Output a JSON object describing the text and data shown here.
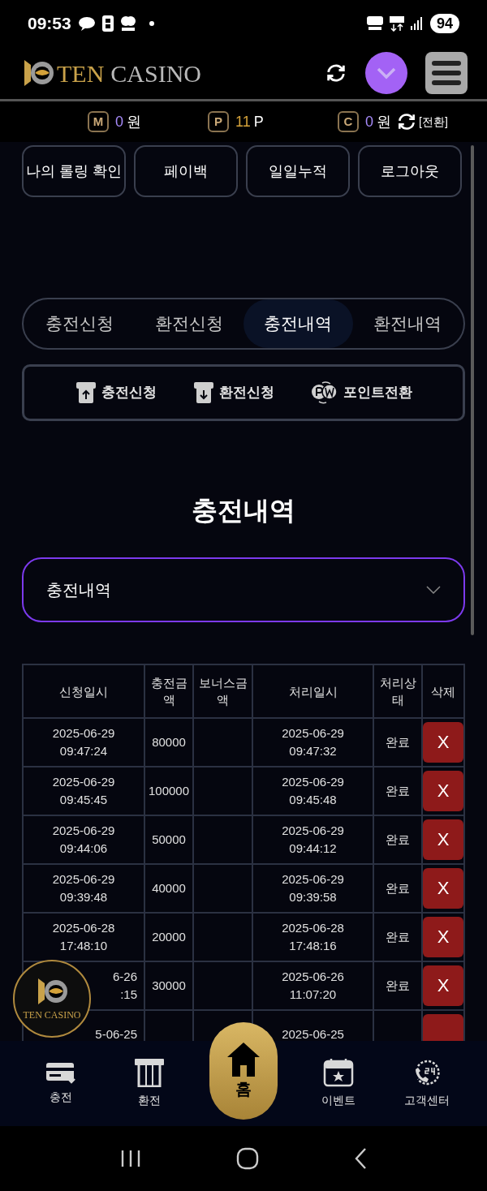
{
  "status_bar": {
    "time": "09:53",
    "battery": "94"
  },
  "header": {
    "logo_left": "TEN",
    "logo_right": "CASINO"
  },
  "balances": [
    {
      "badge": "M",
      "amount": "0",
      "unit": "원",
      "color": "#a78bfa"
    },
    {
      "badge": "P",
      "amount": "11",
      "unit": "P",
      "color": "#d4a23a"
    },
    {
      "badge": "C",
      "amount": "0",
      "unit": "원",
      "color": "#a78bfa"
    }
  ],
  "convert_link": "[전환]",
  "quick_buttons": [
    "나의 롤링 확인",
    "페이백",
    "일일누적",
    "로그아웃"
  ],
  "tabs": [
    {
      "label": "충전신청",
      "selected": false
    },
    {
      "label": "환전신청",
      "selected": false
    },
    {
      "label": "충전내역",
      "selected": true
    },
    {
      "label": "환전내역",
      "selected": false
    }
  ],
  "actions": [
    {
      "label": "충전신청",
      "kind": "deposit"
    },
    {
      "label": "환전신청",
      "kind": "withdraw"
    },
    {
      "label": "포인트전환",
      "kind": "points"
    }
  ],
  "section_title": "충전내역",
  "history_select": {
    "value": "충전내역"
  },
  "table": {
    "columns": [
      "신청일시",
      "충전금액",
      "보너스금액",
      "처리일시",
      "처리상태",
      "삭제"
    ],
    "rows": [
      {
        "requested": [
          "2025-06-29",
          "09:47:24"
        ],
        "amount": "80000",
        "processed": [
          "2025-06-29",
          "09:47:32"
        ],
        "status": "완료",
        "delete": "X"
      },
      {
        "requested": [
          "2025-06-29",
          "09:45:45"
        ],
        "amount": "100000",
        "processed": [
          "2025-06-29",
          "09:45:48"
        ],
        "status": "완료",
        "delete": "X"
      },
      {
        "requested": [
          "2025-06-29",
          "09:44:06"
        ],
        "amount": "50000",
        "processed": [
          "2025-06-29",
          "09:44:12"
        ],
        "status": "완료",
        "delete": "X"
      },
      {
        "requested": [
          "2025-06-29",
          "09:39:48"
        ],
        "amount": "40000",
        "processed": [
          "2025-06-29",
          "09:39:58"
        ],
        "status": "완료",
        "delete": "X"
      },
      {
        "requested": [
          "2025-06-28",
          "17:48:10"
        ],
        "amount": "20000",
        "processed": [
          "2025-06-28",
          "17:48:16"
        ],
        "status": "완료",
        "delete": "X"
      },
      {
        "requested": [
          "6-26",
          ":15"
        ],
        "amount": "30000",
        "processed": [
          "2025-06-26",
          "11:07:20"
        ],
        "status": "완료",
        "delete": "X"
      },
      {
        "requested": [
          "5-06-25"
        ],
        "processed": [
          "2025-06-25"
        ]
      }
    ]
  },
  "floating_badge": {
    "text": "TEN CASINO"
  },
  "bottom_nav": [
    {
      "label": "충전",
      "kind": "card"
    },
    {
      "label": "환전",
      "kind": "atm"
    },
    {
      "label": "홈",
      "kind": "home"
    },
    {
      "label": "이벤트",
      "kind": "calendar"
    },
    {
      "label": "고객센터",
      "kind": "support"
    }
  ]
}
